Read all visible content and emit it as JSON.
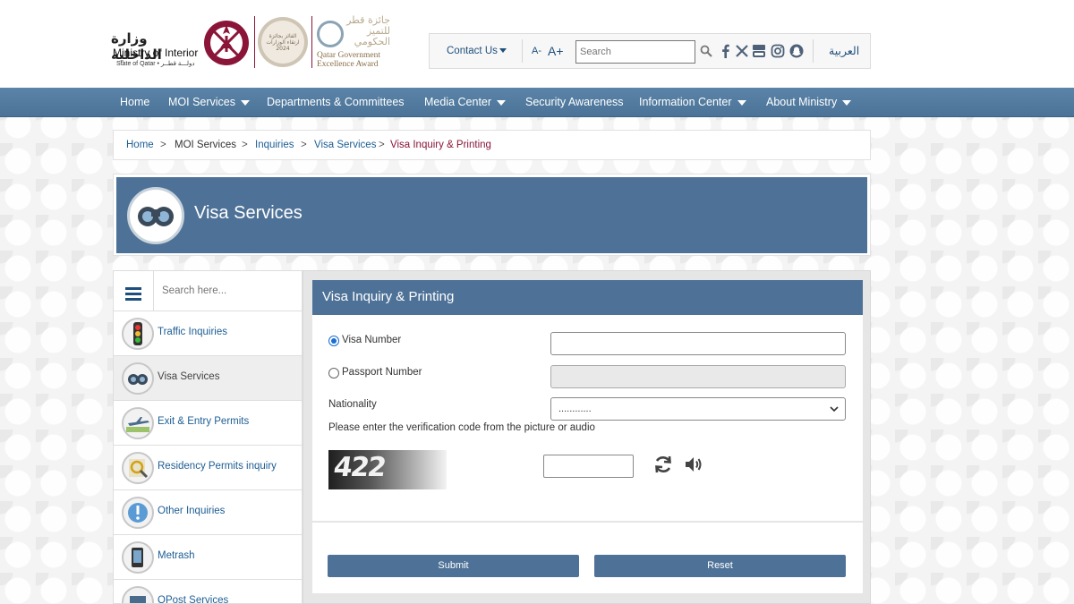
{
  "header": {
    "moi_logo_arabic": "وزارة الداخلية",
    "moi_logo_english": "Ministry of Interior",
    "moi_logo_sub": "State of Qatar • دولـــة قطــر",
    "award_badge_text": "الفائز بجائزة\nارتقاء الوزارات\n2024",
    "qge_arabic_line1": "جائزة قطر",
    "qge_arabic_line2": "للتميز",
    "qge_arabic_line3": "الحكومي",
    "qge_english_line1": "Qatar Government",
    "qge_english_line2": "Excellence Award"
  },
  "utility": {
    "contact_label": "Contact Us",
    "font_decrease": "A-",
    "font_increase": "A+",
    "search_placeholder": "Search",
    "social_icons": [
      "facebook-icon",
      "x-icon",
      "youtube-icon",
      "instagram-icon",
      "snapchat-icon"
    ],
    "language_label": "العربية"
  },
  "nav": {
    "items": [
      {
        "label": "Home",
        "dropdown": false
      },
      {
        "label": "MOI Services",
        "dropdown": true
      },
      {
        "label": "Departments & Committees",
        "dropdown": false
      },
      {
        "label": "Media Center",
        "dropdown": true
      },
      {
        "label": "Security Awareness",
        "dropdown": false
      },
      {
        "label": "Information Center",
        "dropdown": true
      },
      {
        "label": "About Ministry",
        "dropdown": true
      }
    ]
  },
  "breadcrumb": {
    "items": [
      "Home",
      "MOI Services",
      "Inquiries",
      "Visa Services",
      "Visa Inquiry & Printing"
    ],
    "separator": ">"
  },
  "banner": {
    "title": "Visa Services"
  },
  "sidebar": {
    "search_placeholder": "Search here...",
    "items": [
      {
        "label": "Traffic Inquiries",
        "icon": "traffic-light-icon",
        "active": false
      },
      {
        "label": "Visa Services",
        "icon": "binoculars-icon",
        "active": true
      },
      {
        "label": "Exit & Entry Permits",
        "icon": "airplane-icon",
        "active": false
      },
      {
        "label": "Residency Permits inquiry",
        "icon": "magnifier-icon",
        "active": false
      },
      {
        "label": "Other Inquiries",
        "icon": "exclamation-icon",
        "active": false
      },
      {
        "label": "Metrash",
        "icon": "mobile-phone-icon",
        "active": false
      },
      {
        "label": "QPost Services",
        "icon": "qpost-icon",
        "active": false
      }
    ]
  },
  "form": {
    "title": "Visa Inquiry & Printing",
    "visa_number_label": "Visa Number",
    "visa_number_value": "",
    "passport_number_label": "Passport Number",
    "passport_number_value": "",
    "selected_option": "Visa Number",
    "nationality_label": "Nationality",
    "nationality_value": "............",
    "verification_prompt": "Please enter the verification code from the picture or audio",
    "captcha_text": "422",
    "captcha_input_value": "",
    "submit_label": "Submit",
    "reset_label": "Reset"
  },
  "colors": {
    "brand_blue": "#4e7297",
    "link_blue": "#1d5e94",
    "maroon": "#8a1538"
  }
}
